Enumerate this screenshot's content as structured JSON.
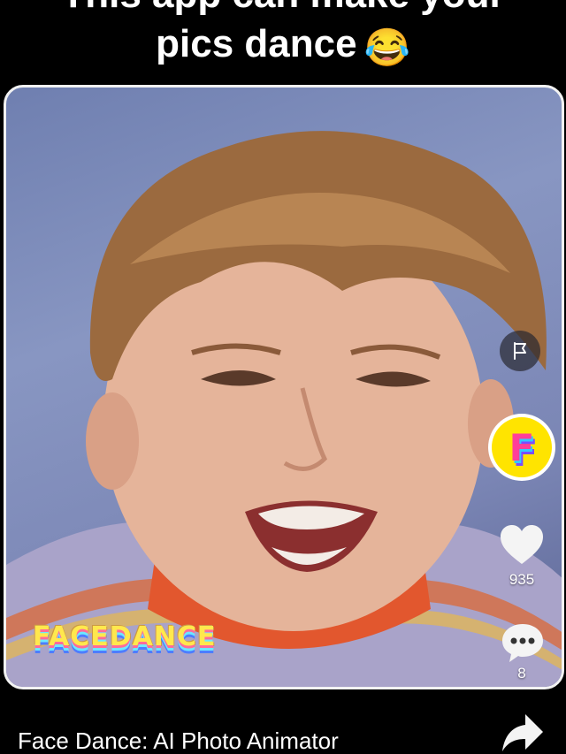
{
  "header": {
    "caption_line1": "This app can make your",
    "caption_line2": "pics dance",
    "caption_emoji": "😂"
  },
  "video": {
    "watermark": "FACEDANCE"
  },
  "sidebar": {
    "flag_icon": "flag-icon",
    "avatar_letter": "F",
    "like_icon": "heart-icon",
    "like_count": "935",
    "comment_icon": "comment-bubble-icon",
    "comment_count": "8",
    "share_icon": "share-arrow-icon"
  },
  "footer": {
    "app_title": "Face Dance: AI Photo Animator"
  },
  "colors": {
    "background": "#000000",
    "avatar_yellow": "#ffe400",
    "avatar_pink": "#ff3f9a",
    "watermark_yellow": "#ffe84d"
  }
}
